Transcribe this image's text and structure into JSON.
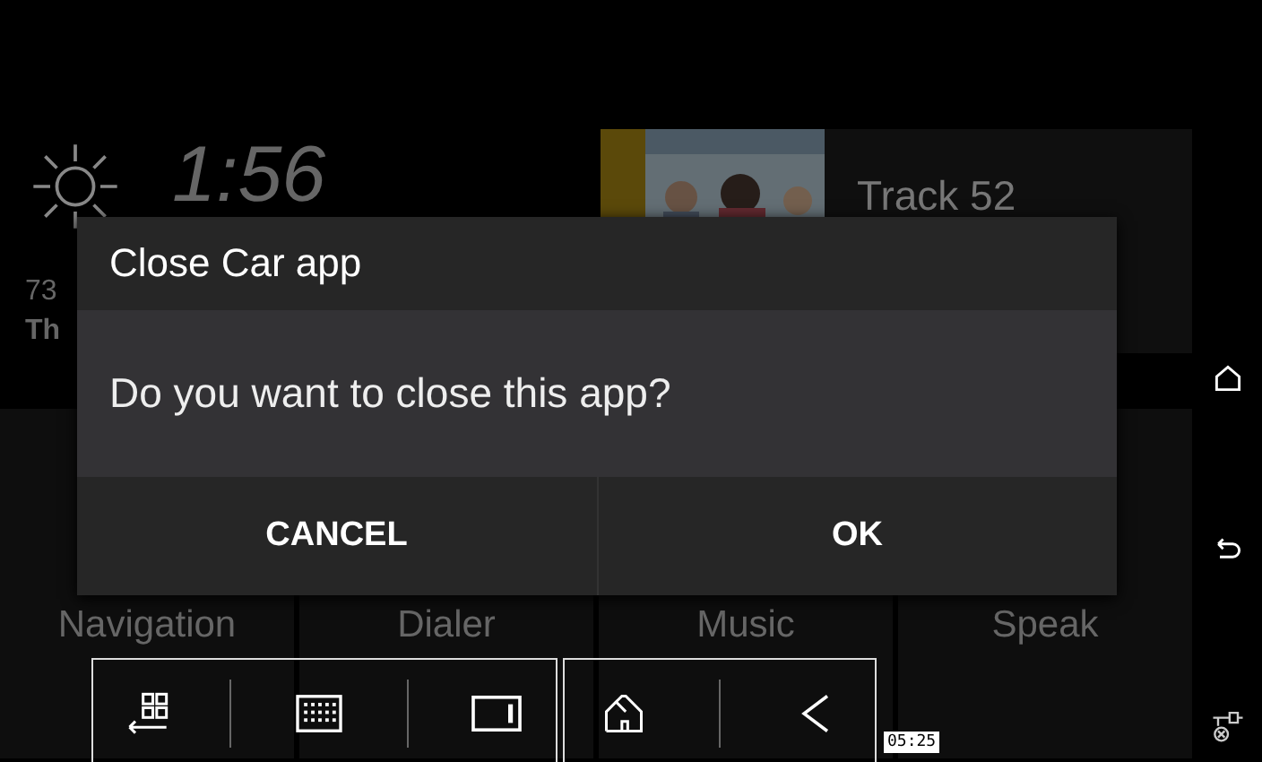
{
  "home": {
    "weather": {
      "clock": "1:56",
      "temperature": "73",
      "day": "Th"
    },
    "media": {
      "track": "Track 52"
    },
    "tiles": [
      {
        "label": "Navigation"
      },
      {
        "label": "Dialer"
      },
      {
        "label": "Music"
      },
      {
        "label": "Speak"
      }
    ]
  },
  "dialog": {
    "title": "Close Car app",
    "message": "Do you want to close this app?",
    "buttons": [
      "CANCEL",
      "OK"
    ]
  },
  "floating_toolbar": {
    "time_tag": "05:25"
  }
}
